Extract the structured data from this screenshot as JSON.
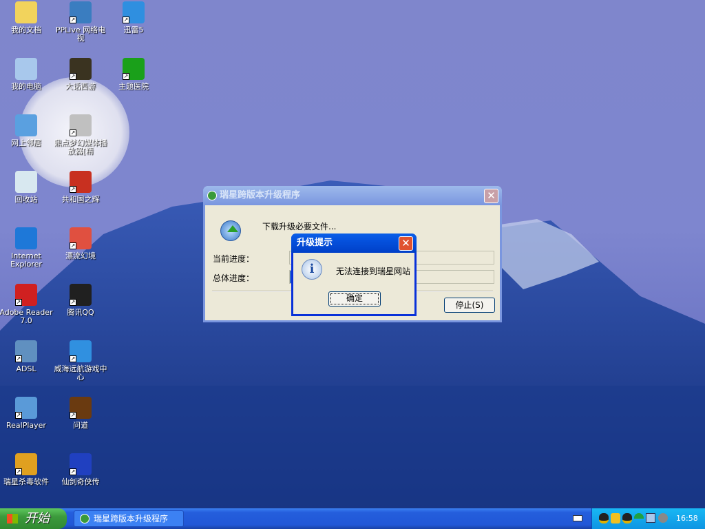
{
  "desktop_icons": [
    {
      "label": "我的文档",
      "col": 0,
      "row": 0,
      "color": "#f2d35c",
      "shortcut": false,
      "icon": "my-documents-icon"
    },
    {
      "label": "PPLive 网络电视",
      "col": 1,
      "row": 0,
      "color": "#3a7dc0",
      "shortcut": true,
      "icon": "pplive-icon"
    },
    {
      "label": "迅雷5",
      "col": 2,
      "row": 0,
      "color": "#2f8fe0",
      "shortcut": true,
      "icon": "thunder-icon"
    },
    {
      "label": "我的电脑",
      "col": 0,
      "row": 1,
      "color": "#a8c8ec",
      "shortcut": false,
      "icon": "my-computer-icon"
    },
    {
      "label": "大话西游",
      "col": 1,
      "row": 1,
      "color": "#3a3320",
      "shortcut": true,
      "icon": "dahuaxiyou-icon"
    },
    {
      "label": "主题医院",
      "col": 2,
      "row": 1,
      "color": "#1aa01a",
      "shortcut": true,
      "icon": "theme-hospital-icon"
    },
    {
      "label": "网上邻居",
      "col": 0,
      "row": 2,
      "color": "#5aa0e0",
      "shortcut": false,
      "icon": "network-places-icon"
    },
    {
      "label": "鼎点梦幻媒体播放器[精",
      "col": 1,
      "row": 2,
      "color": "#c0c0c0",
      "shortcut": true,
      "icon": "media-player-icon"
    },
    {
      "label": "回收站",
      "col": 0,
      "row": 3,
      "color": "#d8e8f0",
      "shortcut": false,
      "icon": "recycle-bin-icon"
    },
    {
      "label": "共和国之辉",
      "col": 1,
      "row": 3,
      "color": "#c83020",
      "shortcut": true,
      "icon": "game-icon"
    },
    {
      "label": "Internet Explorer",
      "col": 0,
      "row": 4,
      "color": "#1e78d8",
      "shortcut": false,
      "icon": "ie-icon"
    },
    {
      "label": "漂流幻境",
      "col": 1,
      "row": 4,
      "color": "#e05040",
      "shortcut": true,
      "icon": "game-icon"
    },
    {
      "label": "Adobe Reader 7.0",
      "col": 0,
      "row": 5,
      "color": "#d02020",
      "shortcut": true,
      "icon": "adobe-reader-icon"
    },
    {
      "label": "腾讯QQ",
      "col": 1,
      "row": 5,
      "color": "#202020",
      "shortcut": true,
      "icon": "qq-icon"
    },
    {
      "label": "ADSL",
      "col": 0,
      "row": 6,
      "color": "#6090c0",
      "shortcut": true,
      "icon": "adsl-icon"
    },
    {
      "label": "威海远航游戏中心",
      "col": 1,
      "row": 6,
      "color": "#3090e0",
      "shortcut": true,
      "icon": "dolphin-icon"
    },
    {
      "label": "RealPlayer",
      "col": 0,
      "row": 7,
      "color": "#5a9ad8",
      "shortcut": true,
      "icon": "realplayer-icon"
    },
    {
      "label": "问道",
      "col": 1,
      "row": 7,
      "color": "#6a3a10",
      "shortcut": true,
      "icon": "wendao-icon"
    },
    {
      "label": "瑞星杀毒软件",
      "col": 0,
      "row": 8,
      "color": "#e0a020",
      "shortcut": true,
      "icon": "rising-antivirus-icon"
    },
    {
      "label": "仙剑奇侠传",
      "col": 1,
      "row": 8,
      "color": "#2040c0",
      "shortcut": true,
      "icon": "xianjian-icon"
    }
  ],
  "upgrade_window": {
    "title": "瑞星跨版本升级程序",
    "status": "下载升级必要文件...",
    "current_label": "当前进度：",
    "total_label": "总体进度：",
    "current_progress": 0,
    "total_progress": 1,
    "stop_button": "停止(S)"
  },
  "alert": {
    "title": "升级提示",
    "message": "无法连接到瑞星网站",
    "ok_button": "确定"
  },
  "taskbar": {
    "start": "开始",
    "task": "瑞星跨版本升级程序",
    "clock": "16:58"
  }
}
